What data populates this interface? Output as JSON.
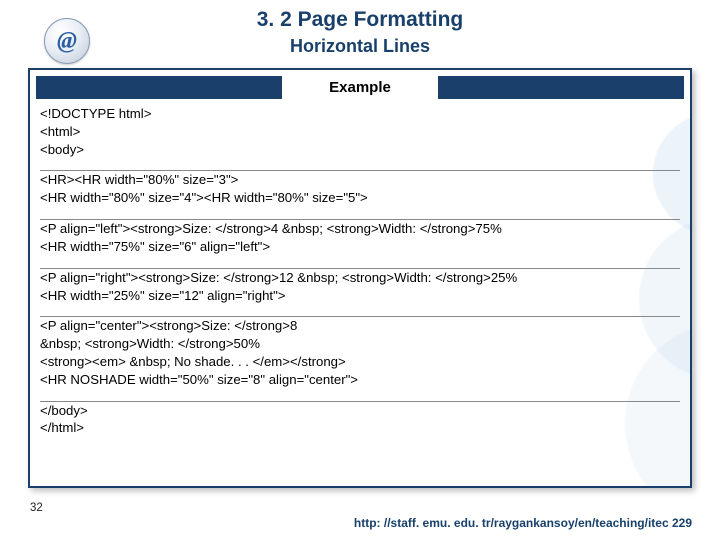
{
  "title": "3. 2 Page Formatting",
  "subtitle": "Horizontal Lines",
  "badge_glyph": "@",
  "example_label": "Example",
  "code": {
    "b1l1": "<!DOCTYPE html>",
    "b1l2": "<html>",
    "b1l3": "<body>",
    "b2l1": "<HR><HR width=\"80%\" size=\"3\">",
    "b2l2": "<HR width=\"80%\" size=\"4\"><HR width=\"80%\" size=\"5\">",
    "b3l1": "<P align=\"left\"><strong>Size: </strong>4 &nbsp; <strong>Width: </strong>75%",
    "b3l2": "<HR width=\"75%\" size=\"6\" align=\"left\">",
    "b4l1": "<P align=\"right\"><strong>Size: </strong>12 &nbsp; <strong>Width: </strong>25%",
    "b4l2": "<HR width=\"25%\" size=\"12\" align=\"right\">",
    "b5l1": "<P align=\"center\"><strong>Size: </strong>8",
    "b5l2": "&nbsp; <strong>Width: </strong>50%",
    "b5l3": "<strong><em> &nbsp; No shade. . . </em></strong>",
    "b5l4": "<HR NOSHADE width=\"50%\" size=\"8\" align=\"center\">",
    "b6l1": "</body>",
    "b6l2": "</html>"
  },
  "page_number": "32",
  "footer_url": "http: //staff. emu. edu. tr/raygankansoy/en/teaching/itec 229"
}
